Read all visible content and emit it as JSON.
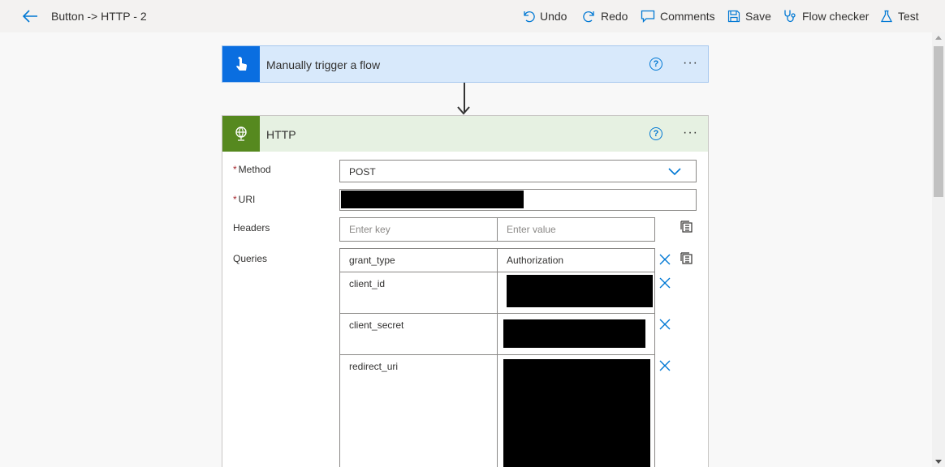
{
  "header": {
    "breadcrumb": "Button -> HTTP - 2",
    "undo": "Undo",
    "redo": "Redo",
    "comments": "Comments",
    "save": "Save",
    "flow_checker": "Flow checker",
    "test": "Test"
  },
  "trigger": {
    "title": "Manually trigger a flow",
    "help": "?",
    "more": "···"
  },
  "http": {
    "title": "HTTP",
    "help": "?",
    "more": "···",
    "method_label": "Method",
    "method_value": "POST",
    "uri_label": "URI",
    "headers_label": "Headers",
    "headers_key_placeholder": "Enter key",
    "headers_value_placeholder": "Enter value",
    "queries_label": "Queries",
    "required_mark": "*",
    "queries": [
      {
        "key": "grant_type",
        "value": "Authorization"
      },
      {
        "key": "client_id",
        "value": ""
      },
      {
        "key": "client_secret",
        "value": ""
      },
      {
        "key": "redirect_uri",
        "value": ""
      }
    ]
  },
  "colors": {
    "accent": "#0078d4",
    "trigger_header": "#d8e9fb",
    "http_header": "#e6f1e2",
    "http_icon": "#56891f",
    "trigger_icon": "#0a6ee0"
  }
}
